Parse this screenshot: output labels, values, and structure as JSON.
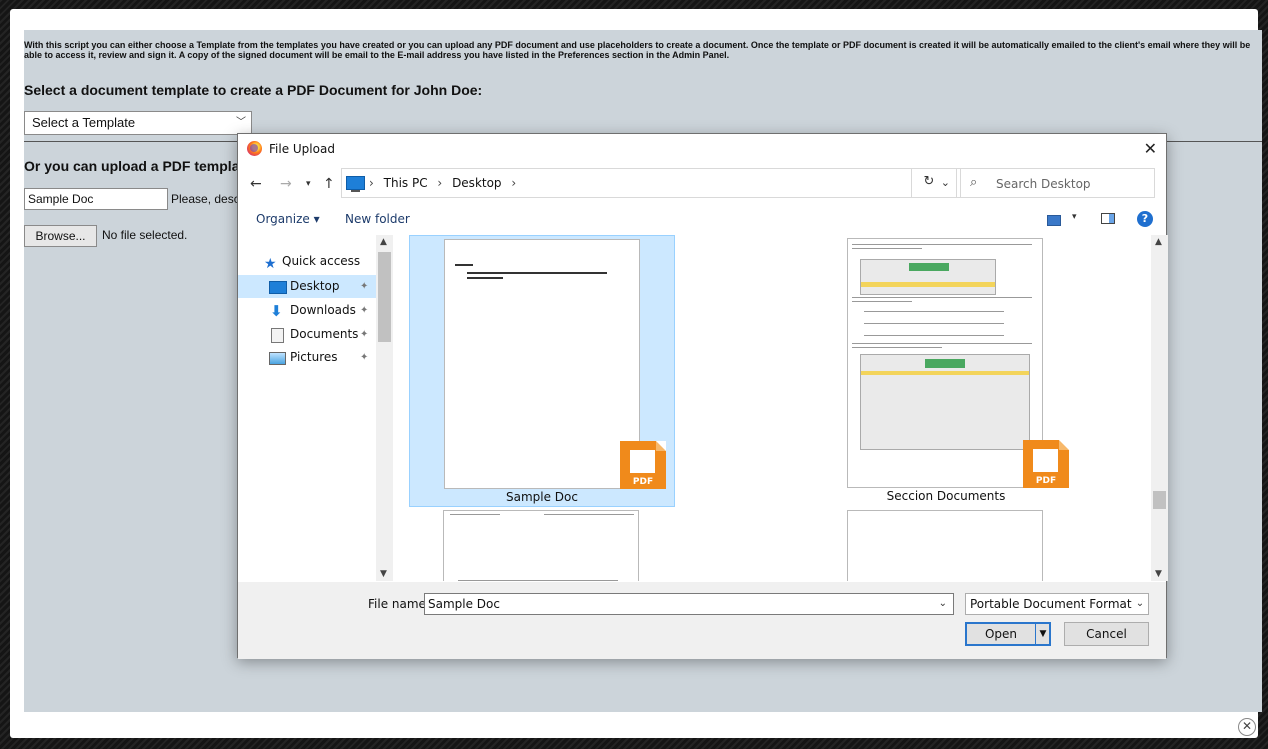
{
  "page": {
    "intro": "With this script you can either choose a Template from the templates you have created or you can upload any PDF document and use placeholders to create a document. Once the template or PDF document is created it will be automatically emailed to the client's email where they will be able to access it, review and sign it. A copy of the signed document will be email to the E-mail address you have listed in the Preferences section in the Admin Panel.",
    "template_heading": "Select a document template to create a PDF Document for John Doe:",
    "template_select": "Select a Template",
    "upload_heading": "Or you can upload a PDF template",
    "doc_name_value": "Sample Doc",
    "describe_text": "Please, describe",
    "browse_label": "Browse...",
    "no_file_text": "No file selected.",
    "close_glyph": "✕"
  },
  "dialog": {
    "title": "File Upload",
    "close_glyph": "✕",
    "breadcrumbs": [
      "This PC",
      "Desktop"
    ],
    "search_placeholder": "Search Desktop",
    "toolbar": {
      "organize": "Organize ▾",
      "new_folder": "New folder"
    },
    "nav_items": [
      {
        "label": "Quick access",
        "icon": "star-icon"
      },
      {
        "label": "Desktop",
        "icon": "desktop-icon",
        "selected": true
      },
      {
        "label": "Downloads",
        "icon": "download-icon"
      },
      {
        "label": "Documents",
        "icon": "documents-icon"
      },
      {
        "label": "Pictures",
        "icon": "pictures-icon"
      }
    ],
    "files": [
      {
        "name": "Sample Doc",
        "selected": true
      },
      {
        "name": "Seccion Documents",
        "selected": false
      }
    ],
    "pdf_badge": "PDF",
    "file_name_label": "File name:",
    "file_name_value": "Sample Doc",
    "file_type": "Portable Document Format (PDF)",
    "open_label": "Open",
    "cancel_label": "Cancel"
  },
  "colors": {
    "page_bg": "#ccd4da",
    "selection": "#cce8ff",
    "pdf_orange": "#f08a1b",
    "accent_blue": "#2a76cc"
  }
}
